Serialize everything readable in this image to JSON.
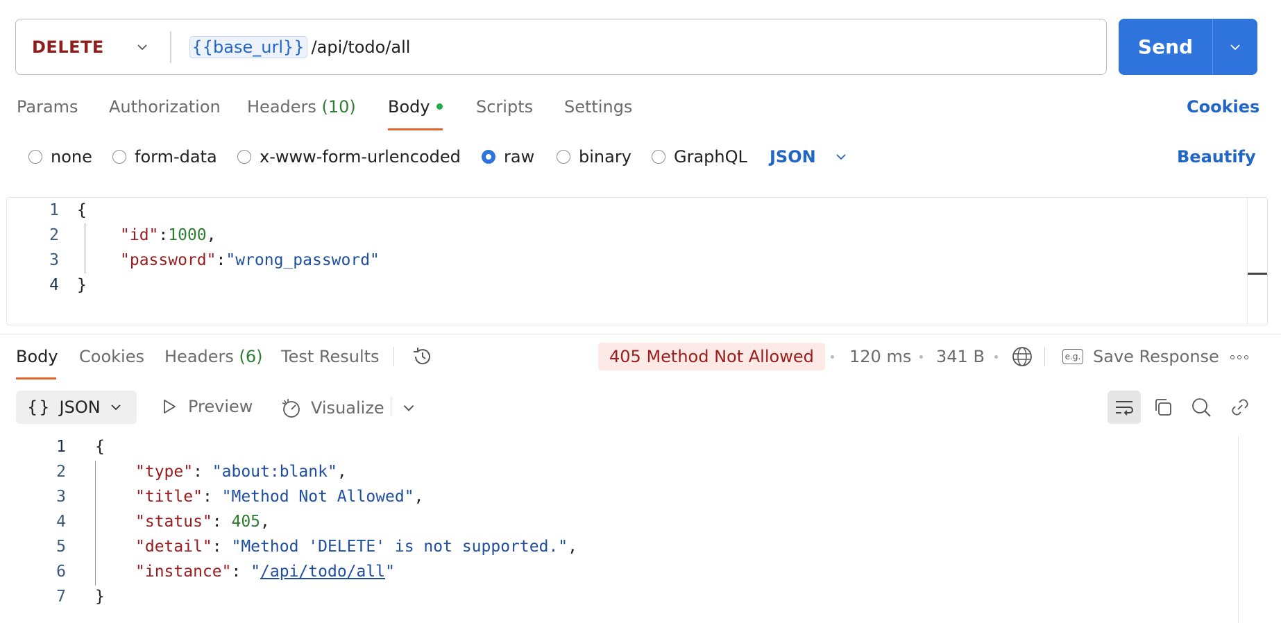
{
  "request": {
    "method": "DELETE",
    "url_variable": "{{base_url}}",
    "url_path": "/api/todo/all",
    "send_label": "Send"
  },
  "request_tabs": {
    "params": "Params",
    "authorization": "Authorization",
    "headers": "Headers",
    "headers_count": "(10)",
    "body": "Body",
    "scripts": "Scripts",
    "settings": "Settings",
    "cookies": "Cookies"
  },
  "body_types": {
    "none": "none",
    "form_data": "form-data",
    "urlencoded": "x-www-form-urlencoded",
    "raw": "raw",
    "binary": "binary",
    "graphql": "GraphQL",
    "selected": "raw",
    "language": "JSON",
    "beautify": "Beautify"
  },
  "request_body": {
    "line_numbers": [
      "1",
      "2",
      "3",
      "4"
    ],
    "open_brace": "{",
    "close_brace": "}",
    "id_key": "\"id\"",
    "colon": ":",
    "id_value": "1000",
    "comma": ",",
    "password_key": "\"password\"",
    "password_value": "\"wrong_password\""
  },
  "response_tabs": {
    "body": "Body",
    "cookies": "Cookies",
    "headers": "Headers",
    "headers_count": "(6)",
    "test_results": "Test Results"
  },
  "response_meta": {
    "status": "405 Method Not Allowed",
    "status_color": "#9b1c1c",
    "time": "120 ms",
    "size": "341 B",
    "save_response": "Save Response",
    "eg_icon_text": "e.g."
  },
  "response_toolbar": {
    "format": "JSON",
    "preview": "Preview",
    "visualize": "Visualize"
  },
  "response_body": {
    "line_numbers": [
      "1",
      "2",
      "3",
      "4",
      "5",
      "6",
      "7"
    ],
    "open_brace": "{",
    "close_brace": "}",
    "type_key": "\"type\"",
    "type_value": "\"about:blank\"",
    "title_key": "\"title\"",
    "title_value": "\"Method Not Allowed\"",
    "status_key": "\"status\"",
    "status_value": "405",
    "detail_key": "\"detail\"",
    "detail_value": "\"Method 'DELETE' is not supported.\"",
    "instance_key": "\"instance\"",
    "instance_quote": "\"",
    "instance_value": "/api/todo/all",
    "sep": ": ",
    "comma": ","
  },
  "colors": {
    "accent_blue": "#2f73dc",
    "tab_underline": "#e8622b",
    "body_dot": "#1fab4a"
  }
}
